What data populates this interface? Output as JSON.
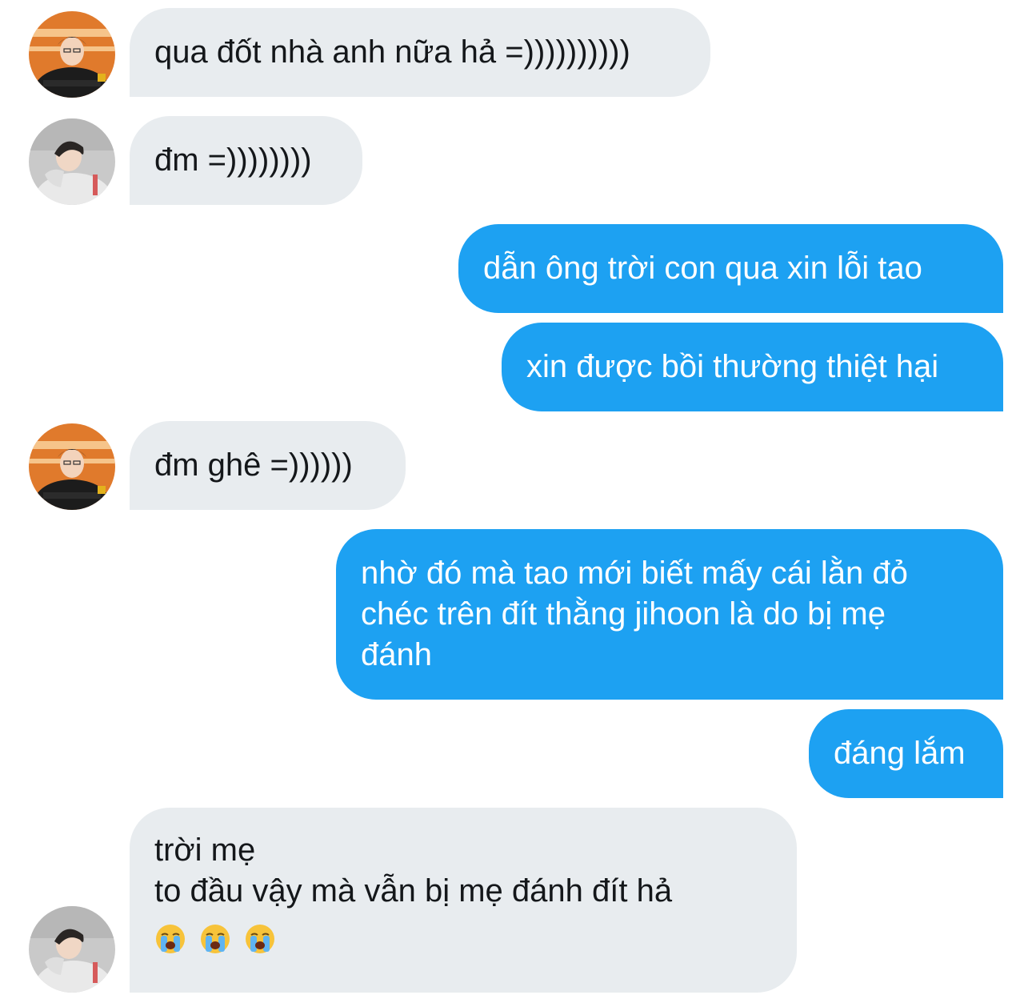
{
  "conversation": {
    "messages": [
      {
        "side": "in",
        "avatar": "avatar-player-jersey",
        "lines": [
          "qua đốt nhà anh nữa hả =))))))))))"
        ]
      },
      {
        "side": "in",
        "avatar": "avatar-player-hoodie",
        "lines": [
          "đm =))))))))"
        ]
      },
      {
        "side": "out",
        "lines": [
          "dẫn ông trời con qua xin lỗi tao"
        ]
      },
      {
        "side": "out",
        "lines": [
          "xin được bồi thường thiệt hại"
        ]
      },
      {
        "side": "in",
        "avatar": "avatar-player-jersey",
        "lines": [
          "đm ghê =))))))"
        ]
      },
      {
        "side": "out",
        "lines": [
          "nhờ đó mà tao mới biết mấy cái lằn đỏ",
          "chéc trên đít thằng jihoon là do bị mẹ",
          "đánh"
        ]
      },
      {
        "side": "out",
        "lines": [
          "đáng lắm"
        ]
      },
      {
        "side": "in",
        "avatar": "avatar-player-hoodie",
        "lines": [
          "trời mẹ",
          "to đầu vậy mà vẫn bị mẹ đánh đít hả"
        ],
        "emojis": [
          "loudly-crying-face-icon",
          "loudly-crying-face-icon",
          "loudly-crying-face-icon"
        ]
      }
    ]
  },
  "colors": {
    "incoming_bubble": "#e8ecef",
    "incoming_text": "#14171a",
    "outgoing_bubble": "#1da1f2",
    "outgoing_text": "#ffffff"
  }
}
